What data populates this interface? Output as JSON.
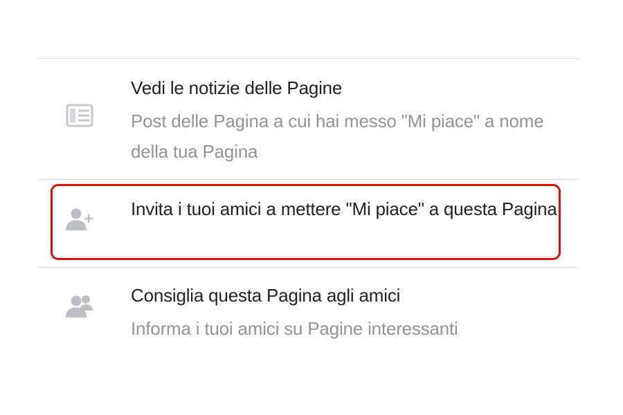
{
  "menu": {
    "items": [
      {
        "icon": "pages-feed-icon",
        "title": "Vedi le notizie delle Pagine",
        "subtitle": "Post delle Pagina a cui hai messo \"Mi piace\" a nome della tua Pagina"
      },
      {
        "icon": "invite-friends-icon",
        "title": "Invita i tuoi amici a mettere \"Mi piace\" a questa Pagina",
        "highlighted": true
      },
      {
        "icon": "recommend-friends-icon",
        "title": "Consiglia questa Pagina agli amici",
        "subtitle": "Informa i tuoi amici su Pagine interessanti"
      }
    ]
  },
  "colors": {
    "title_text": "#1d2129",
    "subtitle_text": "#90949c",
    "icon_gray": "#bec2c9",
    "divider": "#dddfe2",
    "highlight_border": "#e10b0b"
  }
}
